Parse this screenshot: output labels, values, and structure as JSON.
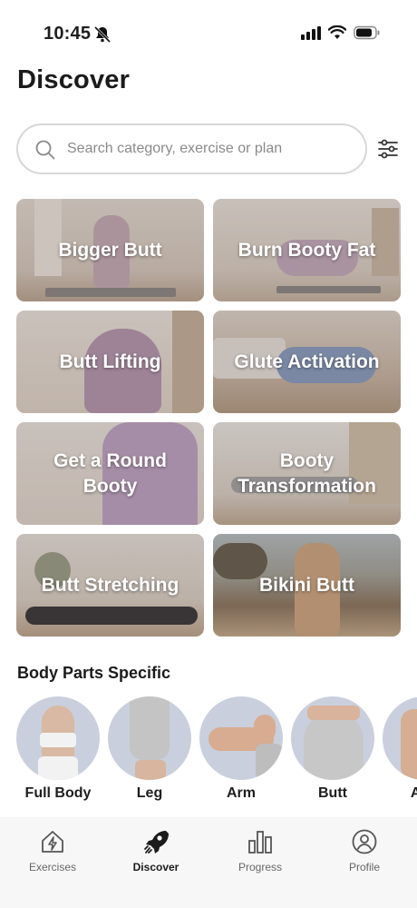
{
  "status_bar": {
    "time": "10:45"
  },
  "page": {
    "title": "Discover"
  },
  "search": {
    "placeholder": "Search category, exercise or plan"
  },
  "categories": [
    {
      "label": "Bigger Butt"
    },
    {
      "label": "Burn Booty Fat"
    },
    {
      "label": "Butt Lifting"
    },
    {
      "label": "Glute Activation"
    },
    {
      "label": "Get a Round\nBooty"
    },
    {
      "label": "Booty\nTransformation"
    },
    {
      "label": "Butt Stretching"
    },
    {
      "label": "Bikini Butt"
    }
  ],
  "body_parts": {
    "title": "Body Parts Specific",
    "items": [
      {
        "label": "Full Body"
      },
      {
        "label": "Leg"
      },
      {
        "label": "Arm"
      },
      {
        "label": "Butt"
      },
      {
        "label": "Abs"
      }
    ]
  },
  "nav": {
    "items": [
      {
        "label": "Exercises",
        "icon": "house-bolt-icon",
        "active": false
      },
      {
        "label": "Discover",
        "icon": "rocket-icon",
        "active": true
      },
      {
        "label": "Progress",
        "icon": "bar-chart-icon",
        "active": false
      },
      {
        "label": "Profile",
        "icon": "user-circle-icon",
        "active": false
      }
    ]
  },
  "colors": {
    "accent": "#1b1b1b",
    "circle_bg": "#c9cfdd",
    "nav_bg": "#f7f7f7"
  }
}
